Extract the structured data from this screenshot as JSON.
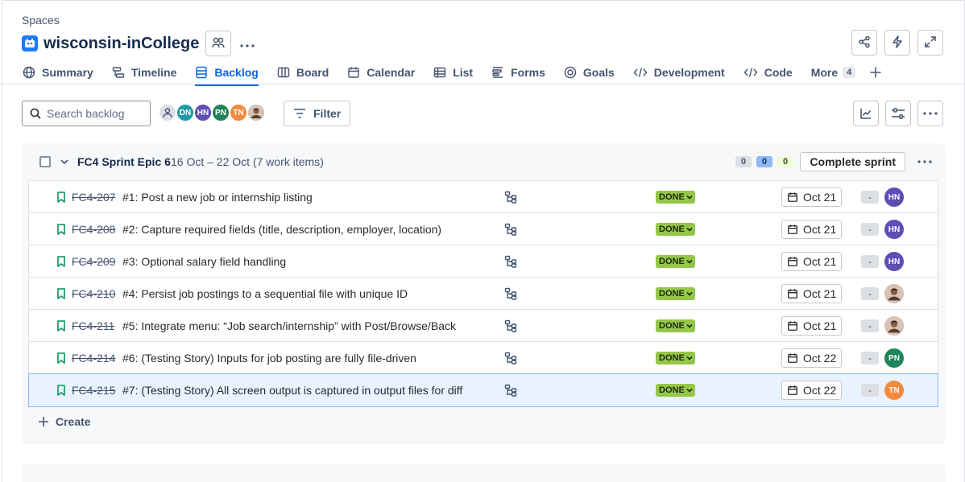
{
  "breadcrumb": "Spaces",
  "project": {
    "name": "wisconsin-inCollege"
  },
  "tabs": [
    {
      "label": "Summary",
      "icon": "globe-icon"
    },
    {
      "label": "Timeline",
      "icon": "timeline-icon"
    },
    {
      "label": "Backlog",
      "icon": "backlog-icon",
      "active": true
    },
    {
      "label": "Board",
      "icon": "board-icon"
    },
    {
      "label": "Calendar",
      "icon": "calendar-icon"
    },
    {
      "label": "List",
      "icon": "list-icon"
    },
    {
      "label": "Forms",
      "icon": "forms-icon"
    },
    {
      "label": "Goals",
      "icon": "goals-icon"
    },
    {
      "label": "Development",
      "icon": "development-icon"
    },
    {
      "label": "Code",
      "icon": "code-icon"
    }
  ],
  "more_tab": {
    "label": "More",
    "count": "4"
  },
  "search": {
    "placeholder": "Search backlog"
  },
  "avatars": [
    {
      "initials": "",
      "color": "#dcdfe4"
    },
    {
      "initials": "DN",
      "color": "#1d9aaa"
    },
    {
      "initials": "HN",
      "color": "#5e4db2"
    },
    {
      "initials": "PN",
      "color": "#1f845a"
    },
    {
      "initials": "TN",
      "color": "#f38a3f"
    },
    {
      "initials": "",
      "color": "#b07a63"
    }
  ],
  "filter_label": "Filter",
  "sprint": {
    "title": "FC4 Sprint Epic 6",
    "dates": "16 Oct – 22 Oct (7 work items)",
    "counts": [
      "0",
      "0",
      "0"
    ],
    "complete_label": "Complete sprint",
    "create_label": "Create",
    "items": [
      {
        "key": "FC4-207",
        "summary": "#1: Post a new job or internship listing",
        "status": "DONE",
        "due": "Oct 21",
        "estimate": "-",
        "assignee": "HN",
        "assignee_color": "#5e4db2"
      },
      {
        "key": "FC4-208",
        "summary": "#2: Capture required fields (title, description, employer, location)",
        "status": "DONE",
        "due": "Oct 21",
        "estimate": "-",
        "assignee": "HN",
        "assignee_color": "#5e4db2"
      },
      {
        "key": "FC4-209",
        "summary": "#3: Optional salary field handling",
        "status": "DONE",
        "due": "Oct 21",
        "estimate": "-",
        "assignee": "HN",
        "assignee_color": "#5e4db2"
      },
      {
        "key": "FC4-210",
        "summary": "#4: Persist job postings to a sequential file with unique ID",
        "status": "DONE",
        "due": "Oct 21",
        "estimate": "-",
        "assignee": "",
        "assignee_color": "#b07a63"
      },
      {
        "key": "FC4-211",
        "summary": "#5: Integrate menu: “Job search/internship” with Post/Browse/Back",
        "status": "DONE",
        "due": "Oct 21",
        "estimate": "-",
        "assignee": "",
        "assignee_color": "#b07a63"
      },
      {
        "key": "FC4-214",
        "summary": "#6: (Testing Story) Inputs for job posting are fully file-driven",
        "status": "DONE",
        "due": "Oct 22",
        "estimate": "-",
        "assignee": "PN",
        "assignee_color": "#1f845a"
      },
      {
        "key": "FC4-215",
        "summary": "#7: (Testing Story) All screen output is captured in output files for diff",
        "status": "DONE",
        "due": "Oct 22",
        "estimate": "-",
        "assignee": "TN",
        "assignee_color": "#f38a3f",
        "selected": true
      }
    ]
  },
  "colors": {
    "accent": "#0c66e4",
    "done": "#94c748",
    "story": "#22a06b"
  }
}
